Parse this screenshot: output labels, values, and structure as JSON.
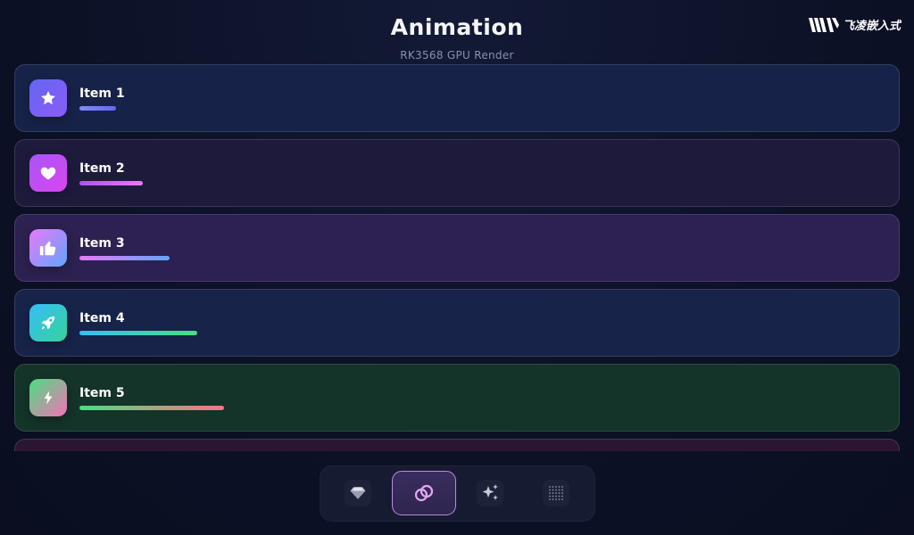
{
  "header": {
    "title": "Animation",
    "subtitle": "RK3568 GPU Render",
    "logo_text": "飞凌嵌入式"
  },
  "list": {
    "items": [
      {
        "label": "Item 1",
        "icon": "star-icon",
        "progress": 0.04,
        "card_color": "#172249",
        "icon_colors": [
          "#6366f1",
          "#8b5cf6"
        ],
        "bar_colors": [
          "#818cf8",
          "#6366f1"
        ]
      },
      {
        "label": "Item 2",
        "icon": "heart-icon",
        "progress": 0.07,
        "card_color": "#1e1a3c",
        "icon_colors": [
          "#a855f7",
          "#d946ef"
        ],
        "bar_colors": [
          "#a855f7",
          "#e879f9"
        ]
      },
      {
        "label": "Item 3",
        "icon": "thumbs-up-icon",
        "progress": 0.1,
        "card_color": "#2c2150",
        "icon_colors": [
          "#e879f9",
          "#60a5fa"
        ],
        "bar_colors": [
          "#e879f9",
          "#60a5fa"
        ]
      },
      {
        "label": "Item 4",
        "icon": "rocket-icon",
        "progress": 0.13,
        "card_color": "#172349",
        "icon_colors": [
          "#38bdf8",
          "#34d399"
        ],
        "bar_colors": [
          "#38bdf8",
          "#4ade80"
        ]
      },
      {
        "label": "Item 5",
        "icon": "lightning-icon",
        "progress": 0.16,
        "card_color": "#143329",
        "icon_colors": [
          "#4ade80",
          "#f472b6"
        ],
        "bar_colors": [
          "#4ade80",
          "#fb7185"
        ]
      },
      {
        "label": "",
        "icon": "",
        "progress": 0,
        "card_color": "#2a1633",
        "icon_colors": [
          "#f472b6",
          "#f472b6"
        ],
        "bar_colors": [
          "#f472b6",
          "#f472b6"
        ]
      }
    ]
  },
  "dock": {
    "buttons": [
      {
        "icon": "diamond-icon",
        "active": false
      },
      {
        "icon": "rings-icon",
        "active": true
      },
      {
        "icon": "sparkles-icon",
        "active": false
      },
      {
        "icon": "dot-grid-icon",
        "active": false
      }
    ],
    "accent": "#b98be3"
  }
}
